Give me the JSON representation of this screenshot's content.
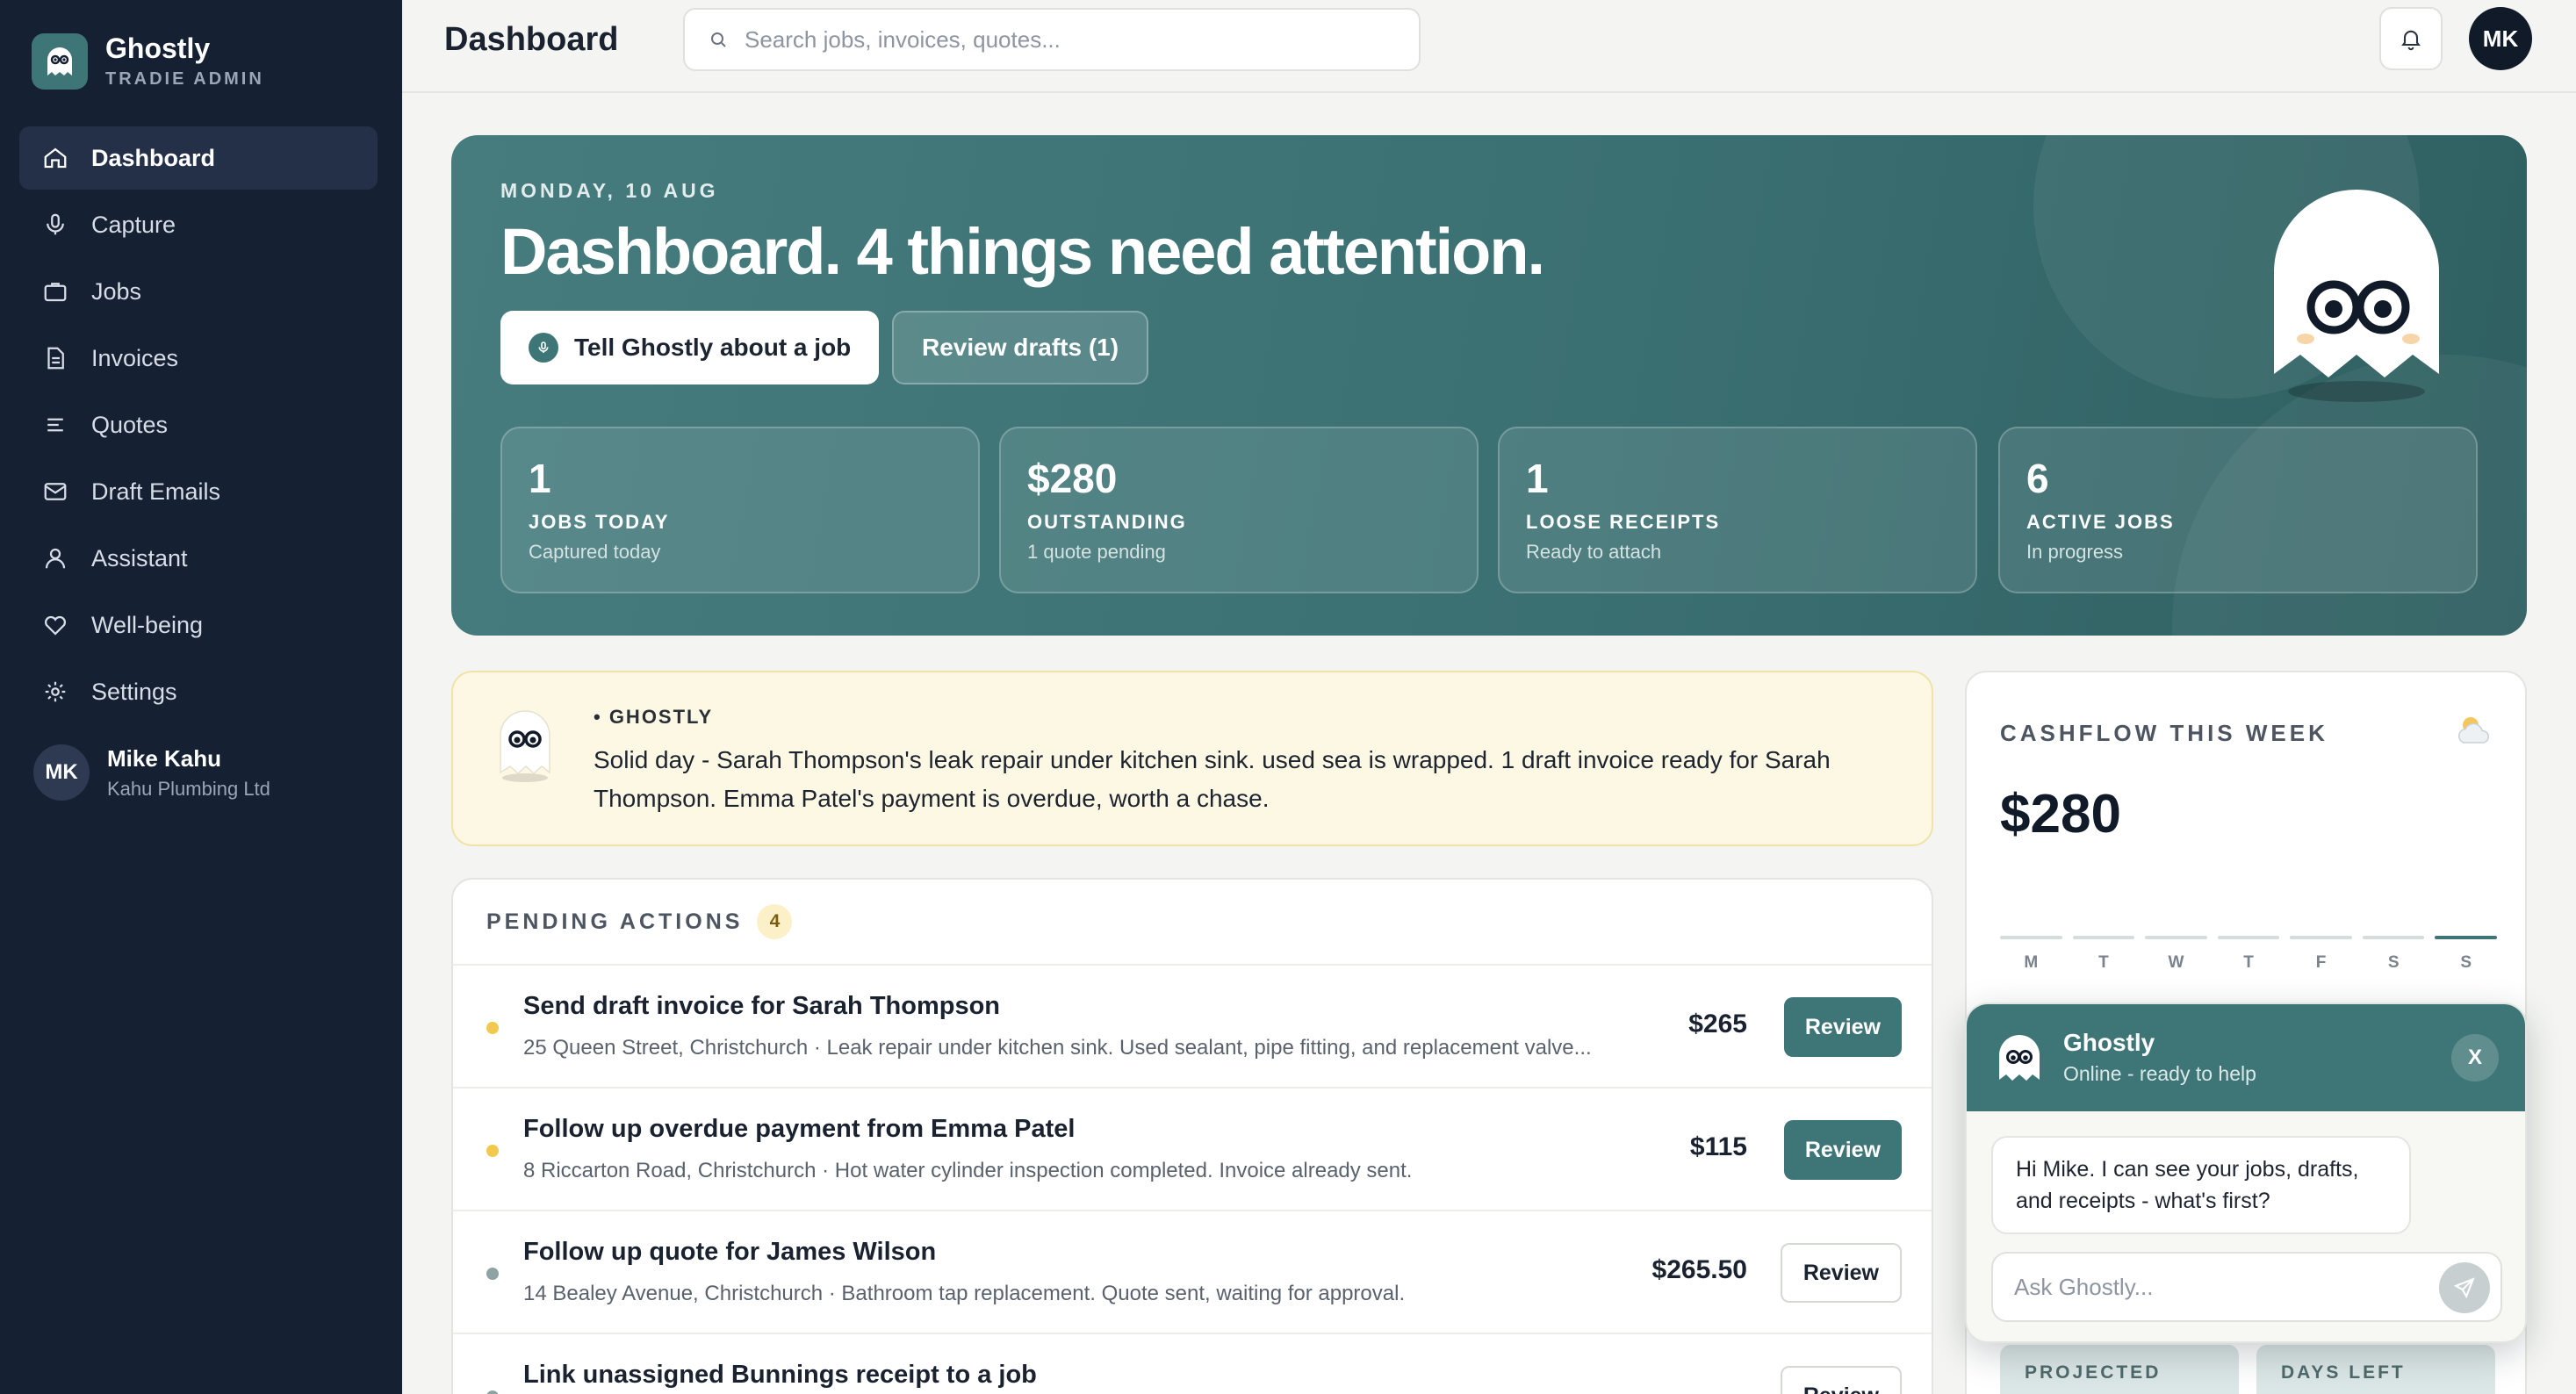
{
  "brand": {
    "name": "Ghostly",
    "subtitle": "TRADIE ADMIN",
    "accent": "#3e7677"
  },
  "sidebar": {
    "items": [
      {
        "label": "Dashboard",
        "icon": "home-icon",
        "active": true
      },
      {
        "label": "Capture",
        "icon": "mic-icon"
      },
      {
        "label": "Jobs",
        "icon": "briefcase-icon"
      },
      {
        "label": "Invoices",
        "icon": "document-icon"
      },
      {
        "label": "Quotes",
        "icon": "list-icon"
      },
      {
        "label": "Draft Emails",
        "icon": "mail-icon"
      },
      {
        "label": "Assistant",
        "icon": "user-icon"
      },
      {
        "label": "Well-being",
        "icon": "heart-icon"
      },
      {
        "label": "Settings",
        "icon": "gear-icon"
      }
    ],
    "user": {
      "initials": "MK",
      "name": "Mike Kahu",
      "company": "Kahu Plumbing Ltd"
    }
  },
  "header": {
    "title": "Dashboard",
    "search_placeholder": "Search jobs, invoices, quotes...",
    "avatar_initials": "MK"
  },
  "hero": {
    "date": "MONDAY, 10 AUG",
    "title": "Dashboard. 4 things need attention.",
    "primary_button": "Tell Ghostly about a job",
    "secondary_button": "Review drafts (1)",
    "stats": [
      {
        "value": "1",
        "label": "JOBS TODAY",
        "sub": "Captured today"
      },
      {
        "value": "$280",
        "label": "OUTSTANDING",
        "sub": "1 quote pending"
      },
      {
        "value": "1",
        "label": "LOOSE RECEIPTS",
        "sub": "Ready to attach"
      },
      {
        "value": "6",
        "label": "ACTIVE JOBS",
        "sub": "In progress"
      }
    ]
  },
  "note": {
    "tag": "• GHOSTLY",
    "text": "Solid day - Sarah Thompson's leak repair under kitchen sink. used sea is wrapped. 1 draft invoice ready for Sarah Thompson. Emma Patel's payment is overdue, worth a chase."
  },
  "pending": {
    "title": "PENDING ACTIONS",
    "count": "4",
    "rows": [
      {
        "title": "Send draft invoice for Sarah Thompson",
        "sub": "25 Queen Street, Christchurch · Leak repair under kitchen sink. Used sealant, pipe fitting, and replacement valve...",
        "amount": "$265",
        "button": "Review",
        "dot": "#f2c94c",
        "style": "solid"
      },
      {
        "title": "Follow up overdue payment from Emma Patel",
        "sub": "8 Riccarton Road, Christchurch · Hot water cylinder inspection completed. Invoice already sent.",
        "amount": "$115",
        "button": "Review",
        "dot": "#f2c94c",
        "style": "solid"
      },
      {
        "title": "Follow up quote for James Wilson",
        "sub": "14 Bealey Avenue, Christchurch · Bathroom tap replacement. Quote sent, waiting for approval.",
        "amount": "$265.50",
        "button": "Review",
        "dot": "#8fa3a3",
        "style": "outline"
      },
      {
        "title": "Link unassigned Bunnings receipt to a job",
        "sub": "",
        "amount": "",
        "button": "Review",
        "dot": "#8fa3a3",
        "style": "outline"
      }
    ]
  },
  "cashflow": {
    "title": "CASHFLOW THIS WEEK",
    "icon": "weather-icon",
    "value": "$280",
    "days": [
      "M",
      "T",
      "W",
      "T",
      "F",
      "S",
      "S"
    ],
    "active_day_index": 6,
    "projected_label": "PROJECTED",
    "days_left_label": "DAYS LEFT"
  },
  "chat": {
    "name": "Ghostly",
    "status": "Online - ready to help",
    "close": "X",
    "message": "Hi Mike. I can see your jobs, drafts, and receipts - what's first?",
    "placeholder": "Ask Ghostly..."
  }
}
